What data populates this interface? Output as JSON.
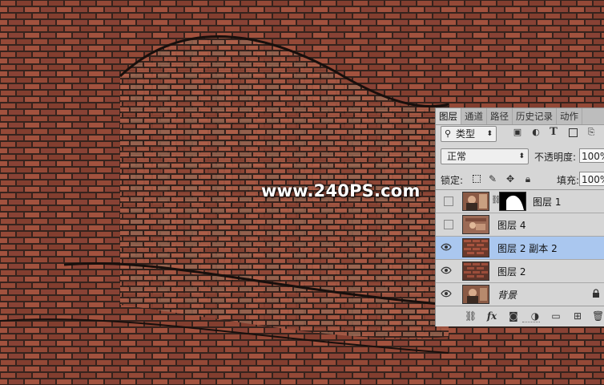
{
  "canvas": {
    "watermark": "www.240PS.com",
    "brick_color": "#9b4b3a",
    "mortar_color": "#3a2a24"
  },
  "layers_panel": {
    "tabs": [
      {
        "label": "图层",
        "active": true
      },
      {
        "label": "通道",
        "active": false
      },
      {
        "label": "路径",
        "active": false
      },
      {
        "label": "历史记录",
        "active": false
      },
      {
        "label": "动作",
        "active": false
      }
    ],
    "filter": {
      "label": "类型",
      "icon": "search-icon"
    },
    "filter_icons": [
      "image-layer-icon",
      "adjustment-layer-icon",
      "text-layer-icon",
      "shape-layer-icon",
      "smart-object-icon"
    ],
    "text_icon_glyph": "T",
    "blend_mode": "正常",
    "opacity_label": "不透明度:",
    "opacity_value": "100%",
    "lock_label": "锁定:",
    "fill_label": "填充:",
    "fill_value": "100%",
    "layers": [
      {
        "name": "图层 1",
        "visible": false,
        "selected": false,
        "has_mask": true,
        "thumb": "portrait"
      },
      {
        "name": "图层 4",
        "visible": false,
        "selected": false,
        "has_mask": false,
        "thumb": "portrait"
      },
      {
        "name": "图层 2 副本 2",
        "visible": true,
        "selected": true,
        "has_mask": false,
        "thumb": "brick"
      },
      {
        "name": "图层 2",
        "visible": true,
        "selected": false,
        "has_mask": false,
        "thumb": "brick"
      },
      {
        "name": "背景",
        "visible": true,
        "selected": false,
        "has_mask": false,
        "thumb": "portrait",
        "locked": true
      }
    ],
    "bottom_icons": [
      "link-layers-icon",
      "fx-icon",
      "add-mask-icon",
      "adjustment-icon",
      "group-icon",
      "new-layer-icon",
      "trash-icon"
    ],
    "fx_label": "fx",
    "selection_color": "#aac7ef"
  }
}
